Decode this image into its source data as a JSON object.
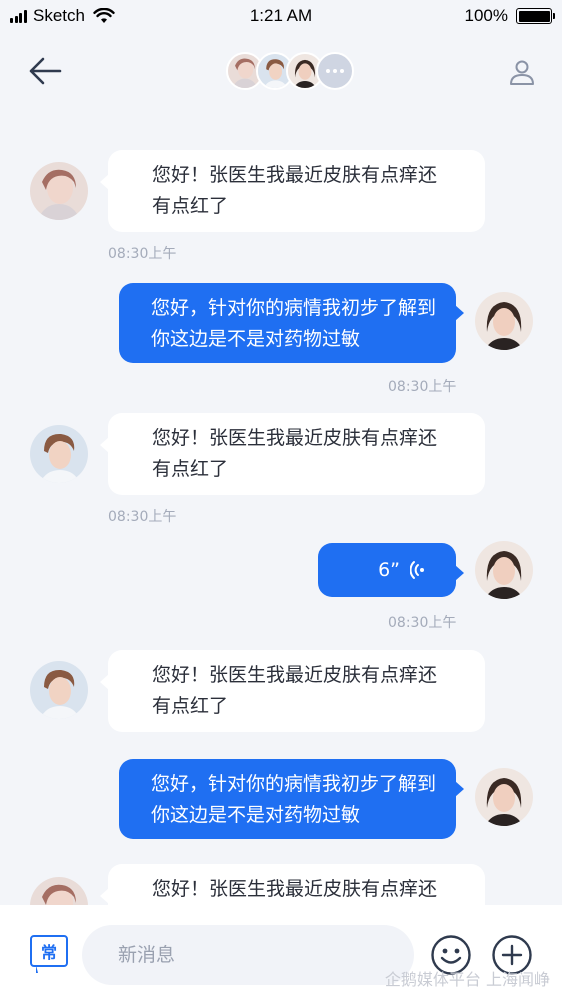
{
  "status_bar": {
    "carrier": "Sketch",
    "time": "1:21 AM",
    "battery": "100%",
    "battery_level": 1.0
  },
  "header": {
    "back_icon": "arrow-left-icon",
    "profile_icon": "person-icon",
    "more_icon": "ellipsis-icon"
  },
  "messages": [
    {
      "side": "in",
      "text_line1": "您好！张医生我最近皮肤有点痒还",
      "text_line2": "有点红了",
      "time": "08:30上午"
    },
    {
      "side": "out",
      "text_line1": "您好，针对你的病情我初步了解到",
      "text_line2": "你这边是不是对药物过敏",
      "time": "08:30上午"
    },
    {
      "side": "in",
      "text_line1": "您好！张医生我最近皮肤有点痒还",
      "text_line2": "有点红了",
      "time": "08:30上午"
    },
    {
      "side": "out",
      "voice": "6”",
      "time": "08:30上午"
    },
    {
      "side": "in",
      "text_line1": "您好！张医生我最近皮肤有点痒还",
      "text_line2": "有点红了"
    },
    {
      "side": "out",
      "text_line1": "您好，针对你的病情我初步了解到",
      "text_line2": "你这边是不是对药物过敏"
    },
    {
      "side": "in",
      "text_line1": "您好！张医生我最近皮肤有点痒还"
    }
  ],
  "input_bar": {
    "quick_reply_label": "常",
    "placeholder": "新消息",
    "emoji_icon": "smile-icon",
    "plus_icon": "plus-circle-icon"
  },
  "watermark": "企鹅媒体平台 上海闻峥",
  "colors": {
    "accent": "#1f6ff2",
    "background": "#f3f5f9",
    "muted": "#a4abba"
  }
}
